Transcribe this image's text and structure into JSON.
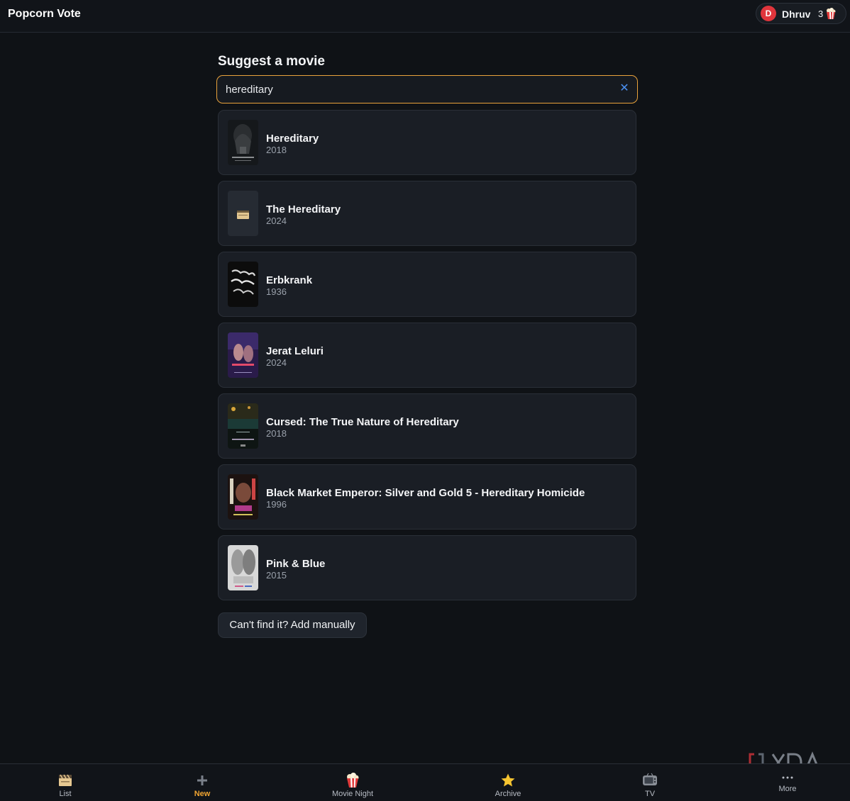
{
  "app": {
    "title": "Popcorn Vote"
  },
  "user": {
    "initial": "D",
    "name": "Dhruv",
    "count": "3"
  },
  "page": {
    "heading": "Suggest a movie"
  },
  "search": {
    "value": "hereditary",
    "clear_icon": "close-icon"
  },
  "results": [
    {
      "title": "Hereditary",
      "year": "2018",
      "poster": "hereditary"
    },
    {
      "title": "The Hereditary",
      "year": "2024",
      "poster": "placeholder-film"
    },
    {
      "title": "Erbkrank",
      "year": "1936",
      "poster": "erbkrank"
    },
    {
      "title": "Jerat Leluri",
      "year": "2024",
      "poster": "jerat"
    },
    {
      "title": "Cursed: The True Nature of Hereditary",
      "year": "2018",
      "poster": "cursed"
    },
    {
      "title": "Black Market Emperor: Silver and Gold 5 - Hereditary Homicide",
      "year": "1996",
      "poster": "black-market"
    },
    {
      "title": "Pink & Blue",
      "year": "2015",
      "poster": "pink-blue"
    }
  ],
  "manual_add": {
    "label": "Can't find it? Add manually"
  },
  "nav": [
    {
      "label": "List",
      "icon": "clapperboard-icon"
    },
    {
      "label": "New",
      "icon": "plus-icon",
      "active": true
    },
    {
      "label": "Movie Night",
      "icon": "popcorn-icon"
    },
    {
      "label": "Archive",
      "icon": "star-icon"
    },
    {
      "label": "TV",
      "icon": "tv-icon"
    },
    {
      "label": "More",
      "icon": "ellipsis-icon"
    }
  ],
  "watermark": {
    "text": "XDA"
  },
  "colors": {
    "accent": "#f0a431",
    "search_border": "#e9a23b",
    "clear_icon": "#4a8ff0",
    "avatar": "#e0353c",
    "background": "#0f1216",
    "card": "#1a1e25"
  }
}
